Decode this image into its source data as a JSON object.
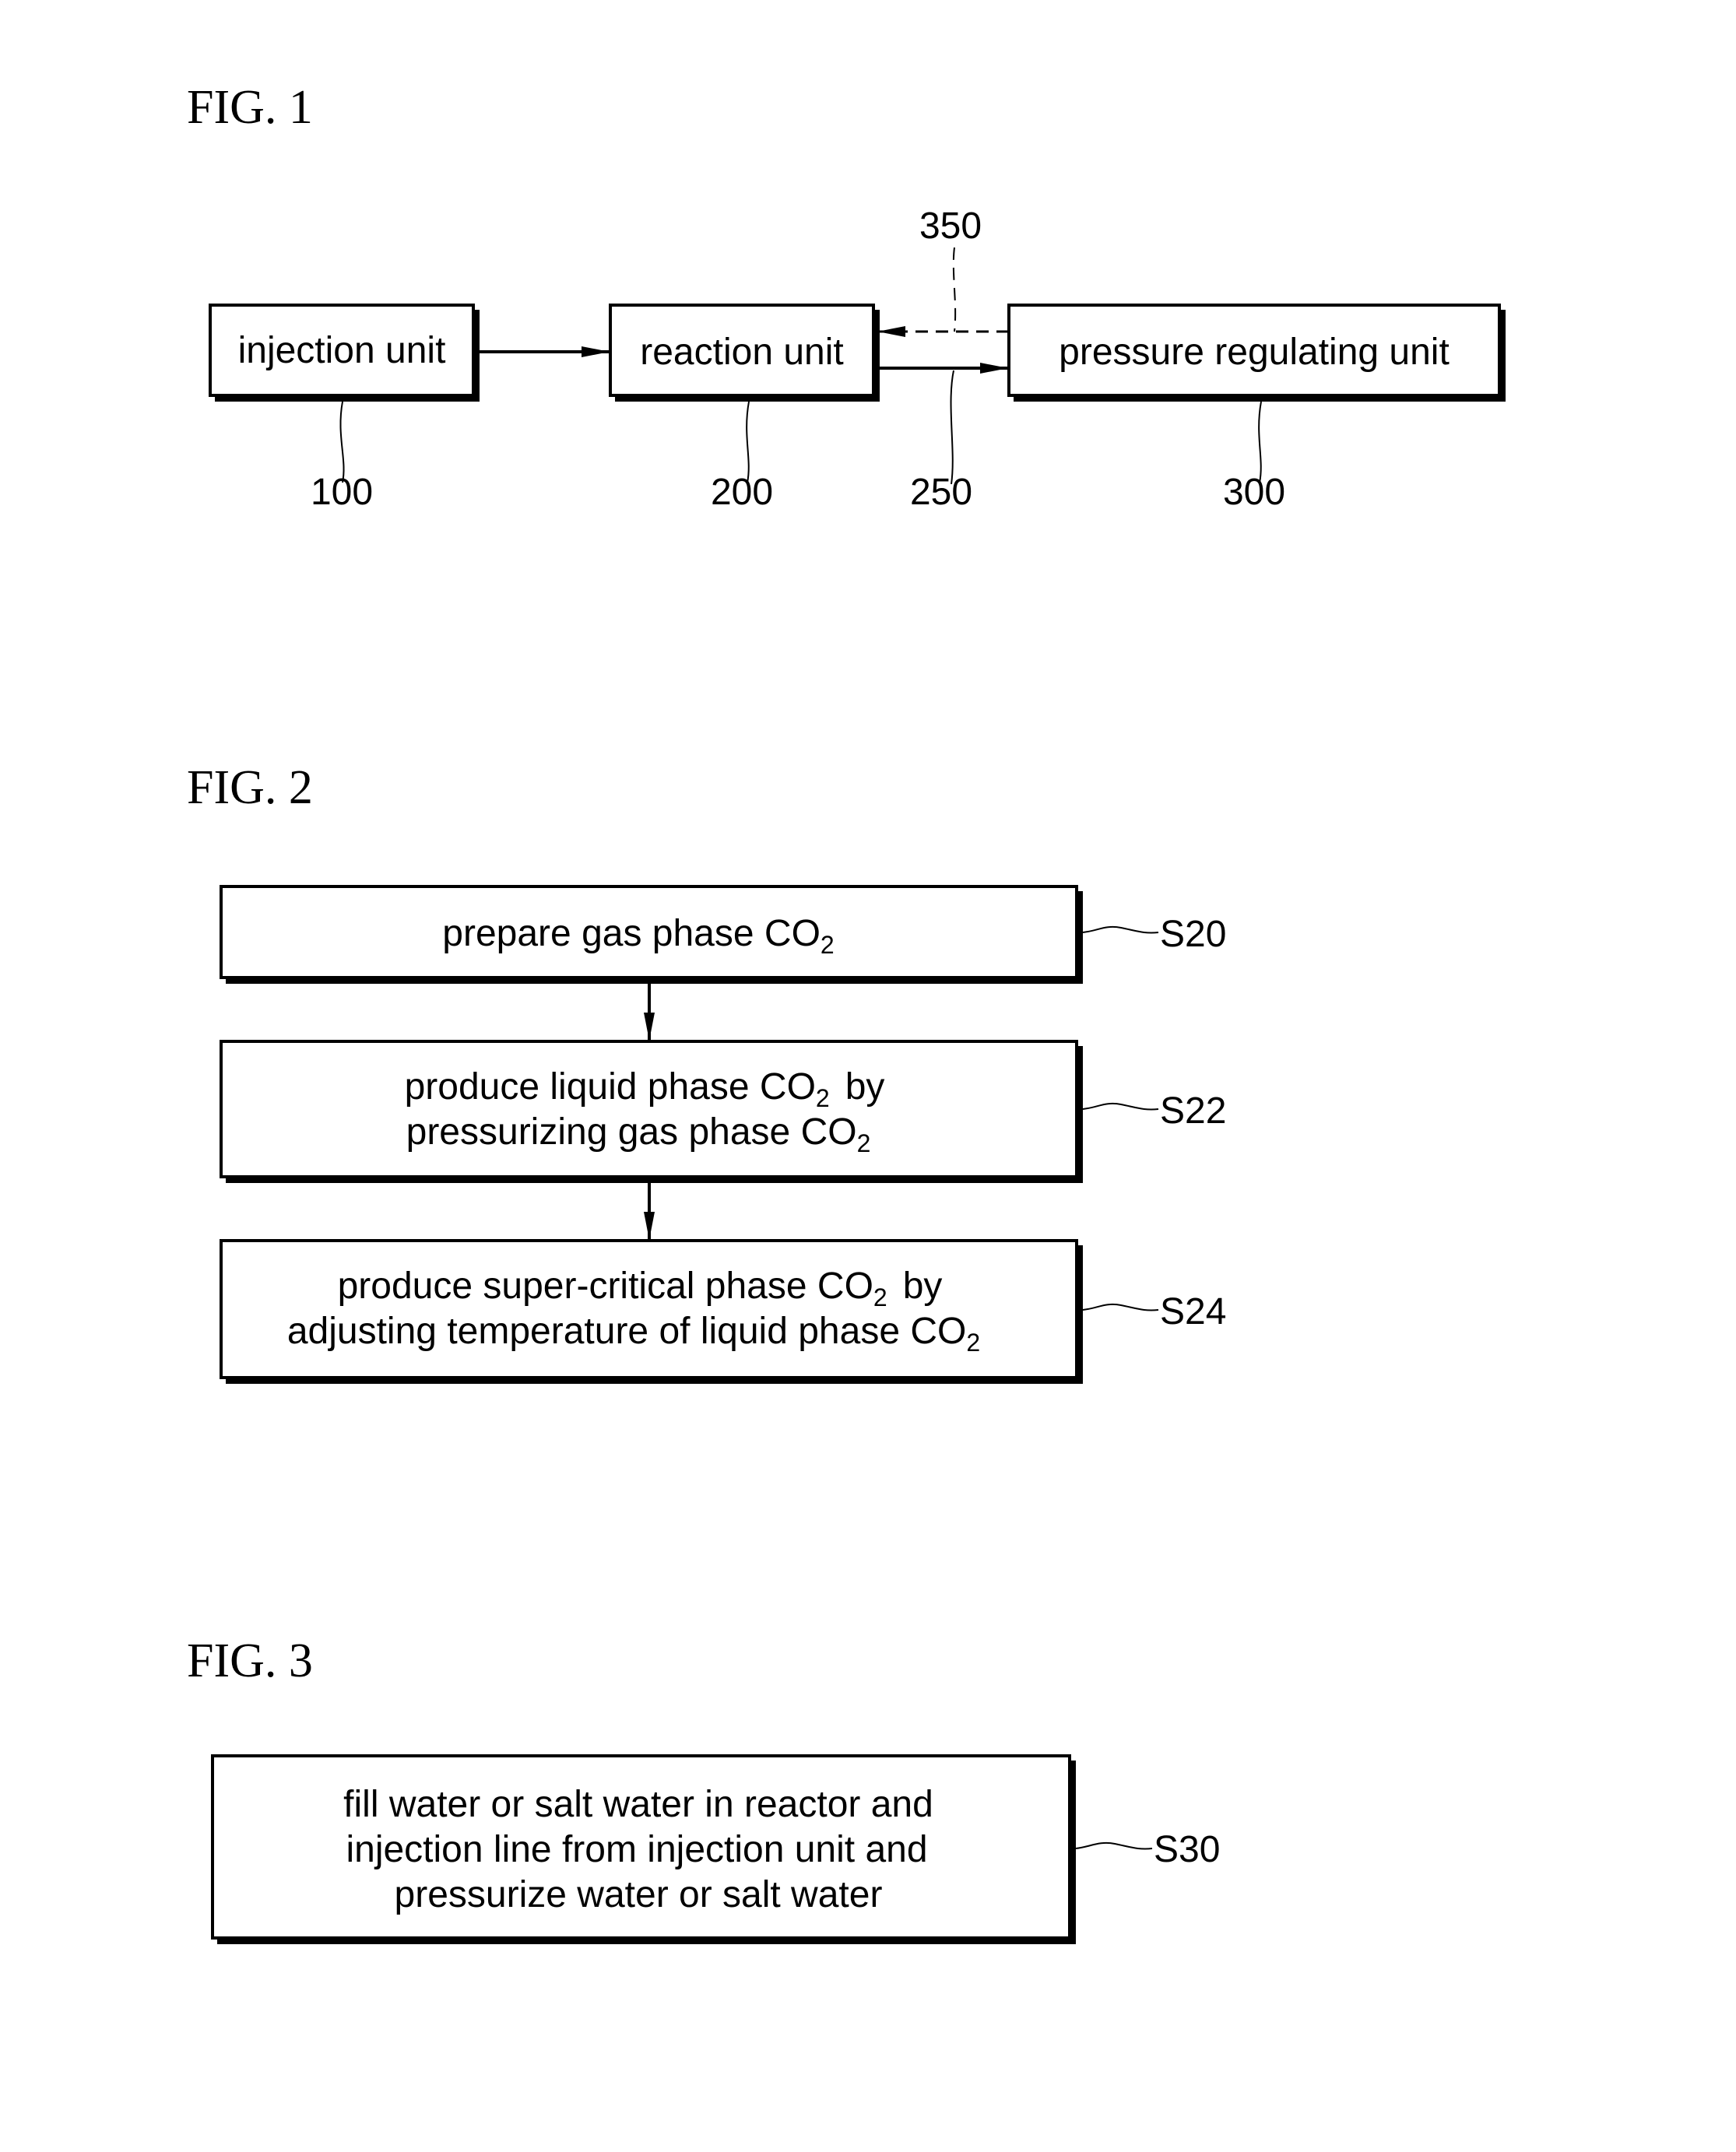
{
  "fig1": {
    "title": "FIG. 1",
    "blocks": [
      {
        "label": "injection unit",
        "ref": "100"
      },
      {
        "label": "reaction unit",
        "ref": "200"
      },
      {
        "label": "pressure regulating unit",
        "ref": "300"
      }
    ],
    "connections": [
      {
        "from": "injection unit",
        "to": "reaction unit",
        "style": "solid"
      },
      {
        "from": "reaction unit",
        "to": "pressure regulating unit",
        "style": "solid",
        "ref": "250"
      },
      {
        "from": "pressure regulating unit",
        "to": "reaction unit",
        "style": "dashed",
        "ref": "350"
      }
    ]
  },
  "fig2": {
    "title": "FIG. 2",
    "steps": [
      {
        "lines": [
          "prepare gas phase CO",
          "2"
        ],
        "ref": "S20"
      },
      {
        "line1": "produce liquid phase CO",
        "line2": "pressurizing gas phase CO",
        "line1_suffix": "by",
        "sub": "2",
        "ref": "S22"
      },
      {
        "line1": "produce super-critical phase CO",
        "line2": "adjusting temperature of liquid phase CO",
        "line1_suffix": "by",
        "sub": "2",
        "ref": "S24"
      }
    ]
  },
  "fig3": {
    "title": "FIG. 3",
    "step": {
      "lines": [
        "fill water or salt water in reactor and",
        "injection line from injection unit and",
        "pressurize water or salt water"
      ],
      "ref": "S30"
    }
  }
}
